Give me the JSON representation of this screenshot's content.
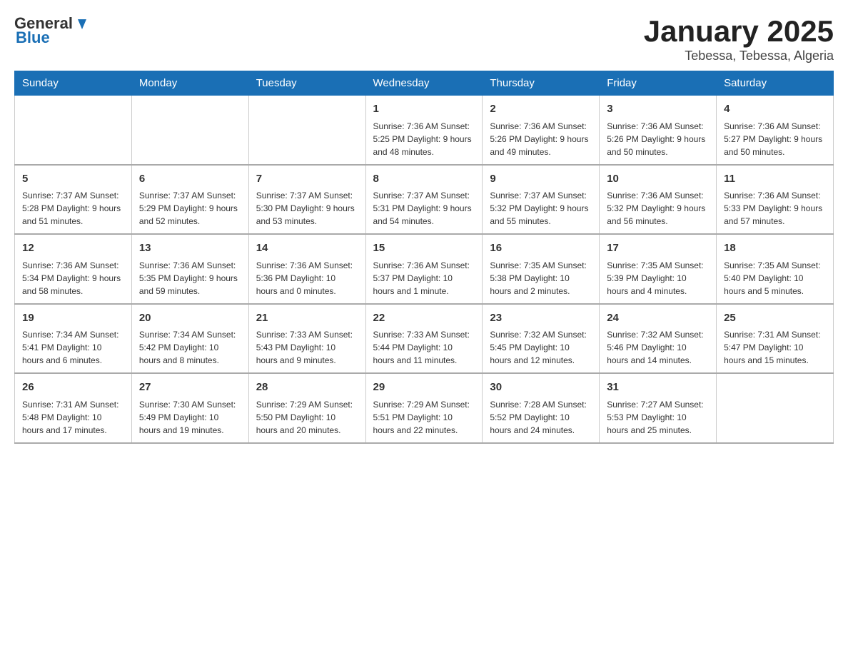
{
  "header": {
    "logo_general": "General",
    "logo_blue": "Blue",
    "title": "January 2025",
    "subtitle": "Tebessa, Tebessa, Algeria"
  },
  "days_of_week": [
    "Sunday",
    "Monday",
    "Tuesday",
    "Wednesday",
    "Thursday",
    "Friday",
    "Saturday"
  ],
  "weeks": [
    [
      {
        "day": "",
        "info": ""
      },
      {
        "day": "",
        "info": ""
      },
      {
        "day": "",
        "info": ""
      },
      {
        "day": "1",
        "info": "Sunrise: 7:36 AM\nSunset: 5:25 PM\nDaylight: 9 hours and 48 minutes."
      },
      {
        "day": "2",
        "info": "Sunrise: 7:36 AM\nSunset: 5:26 PM\nDaylight: 9 hours and 49 minutes."
      },
      {
        "day": "3",
        "info": "Sunrise: 7:36 AM\nSunset: 5:26 PM\nDaylight: 9 hours and 50 minutes."
      },
      {
        "day": "4",
        "info": "Sunrise: 7:36 AM\nSunset: 5:27 PM\nDaylight: 9 hours and 50 minutes."
      }
    ],
    [
      {
        "day": "5",
        "info": "Sunrise: 7:37 AM\nSunset: 5:28 PM\nDaylight: 9 hours and 51 minutes."
      },
      {
        "day": "6",
        "info": "Sunrise: 7:37 AM\nSunset: 5:29 PM\nDaylight: 9 hours and 52 minutes."
      },
      {
        "day": "7",
        "info": "Sunrise: 7:37 AM\nSunset: 5:30 PM\nDaylight: 9 hours and 53 minutes."
      },
      {
        "day": "8",
        "info": "Sunrise: 7:37 AM\nSunset: 5:31 PM\nDaylight: 9 hours and 54 minutes."
      },
      {
        "day": "9",
        "info": "Sunrise: 7:37 AM\nSunset: 5:32 PM\nDaylight: 9 hours and 55 minutes."
      },
      {
        "day": "10",
        "info": "Sunrise: 7:36 AM\nSunset: 5:32 PM\nDaylight: 9 hours and 56 minutes."
      },
      {
        "day": "11",
        "info": "Sunrise: 7:36 AM\nSunset: 5:33 PM\nDaylight: 9 hours and 57 minutes."
      }
    ],
    [
      {
        "day": "12",
        "info": "Sunrise: 7:36 AM\nSunset: 5:34 PM\nDaylight: 9 hours and 58 minutes."
      },
      {
        "day": "13",
        "info": "Sunrise: 7:36 AM\nSunset: 5:35 PM\nDaylight: 9 hours and 59 minutes."
      },
      {
        "day": "14",
        "info": "Sunrise: 7:36 AM\nSunset: 5:36 PM\nDaylight: 10 hours and 0 minutes."
      },
      {
        "day": "15",
        "info": "Sunrise: 7:36 AM\nSunset: 5:37 PM\nDaylight: 10 hours and 1 minute."
      },
      {
        "day": "16",
        "info": "Sunrise: 7:35 AM\nSunset: 5:38 PM\nDaylight: 10 hours and 2 minutes."
      },
      {
        "day": "17",
        "info": "Sunrise: 7:35 AM\nSunset: 5:39 PM\nDaylight: 10 hours and 4 minutes."
      },
      {
        "day": "18",
        "info": "Sunrise: 7:35 AM\nSunset: 5:40 PM\nDaylight: 10 hours and 5 minutes."
      }
    ],
    [
      {
        "day": "19",
        "info": "Sunrise: 7:34 AM\nSunset: 5:41 PM\nDaylight: 10 hours and 6 minutes."
      },
      {
        "day": "20",
        "info": "Sunrise: 7:34 AM\nSunset: 5:42 PM\nDaylight: 10 hours and 8 minutes."
      },
      {
        "day": "21",
        "info": "Sunrise: 7:33 AM\nSunset: 5:43 PM\nDaylight: 10 hours and 9 minutes."
      },
      {
        "day": "22",
        "info": "Sunrise: 7:33 AM\nSunset: 5:44 PM\nDaylight: 10 hours and 11 minutes."
      },
      {
        "day": "23",
        "info": "Sunrise: 7:32 AM\nSunset: 5:45 PM\nDaylight: 10 hours and 12 minutes."
      },
      {
        "day": "24",
        "info": "Sunrise: 7:32 AM\nSunset: 5:46 PM\nDaylight: 10 hours and 14 minutes."
      },
      {
        "day": "25",
        "info": "Sunrise: 7:31 AM\nSunset: 5:47 PM\nDaylight: 10 hours and 15 minutes."
      }
    ],
    [
      {
        "day": "26",
        "info": "Sunrise: 7:31 AM\nSunset: 5:48 PM\nDaylight: 10 hours and 17 minutes."
      },
      {
        "day": "27",
        "info": "Sunrise: 7:30 AM\nSunset: 5:49 PM\nDaylight: 10 hours and 19 minutes."
      },
      {
        "day": "28",
        "info": "Sunrise: 7:29 AM\nSunset: 5:50 PM\nDaylight: 10 hours and 20 minutes."
      },
      {
        "day": "29",
        "info": "Sunrise: 7:29 AM\nSunset: 5:51 PM\nDaylight: 10 hours and 22 minutes."
      },
      {
        "day": "30",
        "info": "Sunrise: 7:28 AM\nSunset: 5:52 PM\nDaylight: 10 hours and 24 minutes."
      },
      {
        "day": "31",
        "info": "Sunrise: 7:27 AM\nSunset: 5:53 PM\nDaylight: 10 hours and 25 minutes."
      },
      {
        "day": "",
        "info": ""
      }
    ]
  ]
}
